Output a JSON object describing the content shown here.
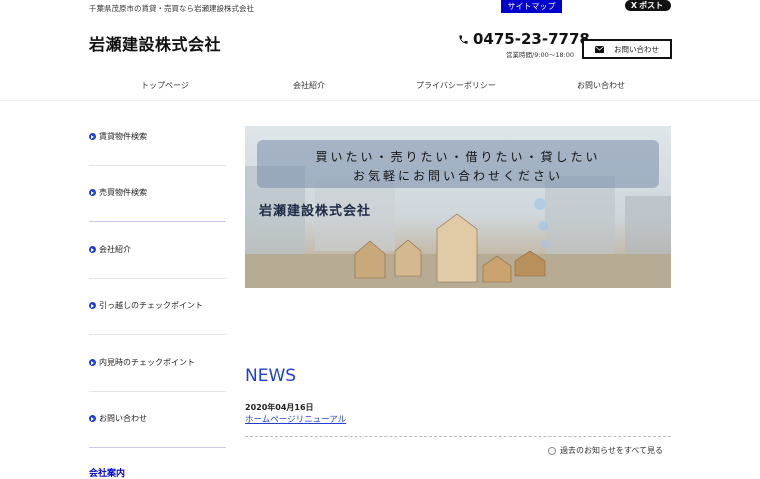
{
  "header": {
    "tagline": "千葉県茂原市の賃貸・売買なら岩瀬建設株式会社",
    "sitemap_label": "サイトマップ",
    "x_post_label": "ポスト",
    "x_logo": "X",
    "company_name": "岩瀬建設株式会社",
    "phone": "0475-23-7778",
    "hours": "営業時間/9:00～18:00",
    "contact_label": "お問い合わせ"
  },
  "nav": {
    "items": [
      {
        "label": "トップページ"
      },
      {
        "label": "会社紹介"
      },
      {
        "label": "プライバシーポリシー"
      },
      {
        "label": "お問い合わせ"
      }
    ]
  },
  "sidebar": {
    "items": [
      {
        "label": "賃貸物件検索"
      },
      {
        "label": "売買物件検索"
      },
      {
        "label": "会社紹介"
      },
      {
        "label": "引っ越しのチェックポイント"
      },
      {
        "label": "内見時のチェックポイント"
      },
      {
        "label": "お問い合わせ"
      }
    ],
    "section_heading": "会社案内"
  },
  "banner": {
    "line1": "買いたい・売りたい・借りたい・貸したい",
    "line2": "お気軽にお問い合わせください",
    "company": "岩瀬建設株式会社"
  },
  "news": {
    "title": "NEWS",
    "entries": [
      {
        "date": "2020年04月16日",
        "title": "ホームページリニューアル"
      }
    ],
    "view_all_label": "過去のお知らせをすべて見る"
  },
  "colors": {
    "accent_blue": "#0000cc",
    "link_blue": "#1f3fd1"
  }
}
